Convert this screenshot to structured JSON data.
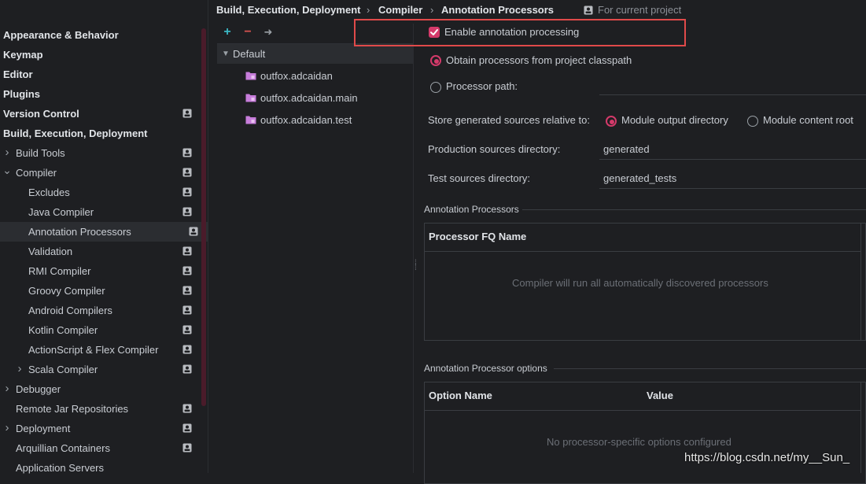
{
  "sidebar": {
    "items": [
      {
        "label": "Appearance & Behavior",
        "bold": true
      },
      {
        "label": "Keymap",
        "bold": true
      },
      {
        "label": "Editor",
        "bold": true
      },
      {
        "label": "Plugins",
        "bold": true
      },
      {
        "label": "Version Control",
        "bold": true,
        "project": true
      },
      {
        "label": "Build, Execution, Deployment",
        "bold": true
      },
      {
        "label": "Build Tools",
        "arrow": "right",
        "project": true
      },
      {
        "label": "Compiler",
        "arrow": "down",
        "project": true
      },
      {
        "label": "Excludes",
        "project": true
      },
      {
        "label": "Java Compiler",
        "project": true
      },
      {
        "label": "Annotation Processors",
        "project": true,
        "selected": true
      },
      {
        "label": "Validation",
        "project": true
      },
      {
        "label": "RMI Compiler",
        "project": true
      },
      {
        "label": "Groovy Compiler",
        "project": true
      },
      {
        "label": "Android Compilers",
        "project": true
      },
      {
        "label": "Kotlin Compiler",
        "project": true
      },
      {
        "label": "ActionScript & Flex Compiler",
        "project": true
      },
      {
        "label": "Scala Compiler",
        "arrow": "right",
        "project": true
      },
      {
        "label": "Debugger",
        "arrow": "right"
      },
      {
        "label": "Remote Jar Repositories",
        "project": true
      },
      {
        "label": "Deployment",
        "arrow": "right",
        "project": true
      },
      {
        "label": "Arquillian Containers",
        "project": true
      },
      {
        "label": "Application Servers"
      }
    ]
  },
  "breadcrumb": {
    "items": [
      "Build, Execution, Deployment",
      "Compiler",
      "Annotation Processors"
    ],
    "separator": "›",
    "scope": "For current project"
  },
  "profiles": {
    "add": "+",
    "remove": "−",
    "move": "➜",
    "default_label": "Default",
    "modules": [
      "outfox.adcaidan",
      "outfox.adcaidan.main",
      "outfox.adcaidan.test"
    ]
  },
  "settings": {
    "enable_label": "Enable annotation processing",
    "obtain_label": "Obtain processors from project classpath",
    "path_label": "Processor path:",
    "store_label": "Store generated sources relative to:",
    "module_output": "Module output directory",
    "module_content": "Module content root",
    "prod_label": "Production sources directory:",
    "prod_value": "generated",
    "test_label": "Test sources directory:",
    "test_value": "generated_tests"
  },
  "processors_section": {
    "title": "Annotation Processors",
    "column": "Processor FQ Name",
    "empty": "Compiler will run all automatically discovered processors"
  },
  "options_section": {
    "title": "Annotation Processor options",
    "col_name": "Option Name",
    "col_value": "Value",
    "empty": "No processor-specific options configured"
  },
  "watermark": "https://blog.csdn.net/my__Sun_",
  "colors": {
    "accent": "#d43a6a",
    "highlight_box": "#e04a4a",
    "background": "#1e1f22"
  }
}
